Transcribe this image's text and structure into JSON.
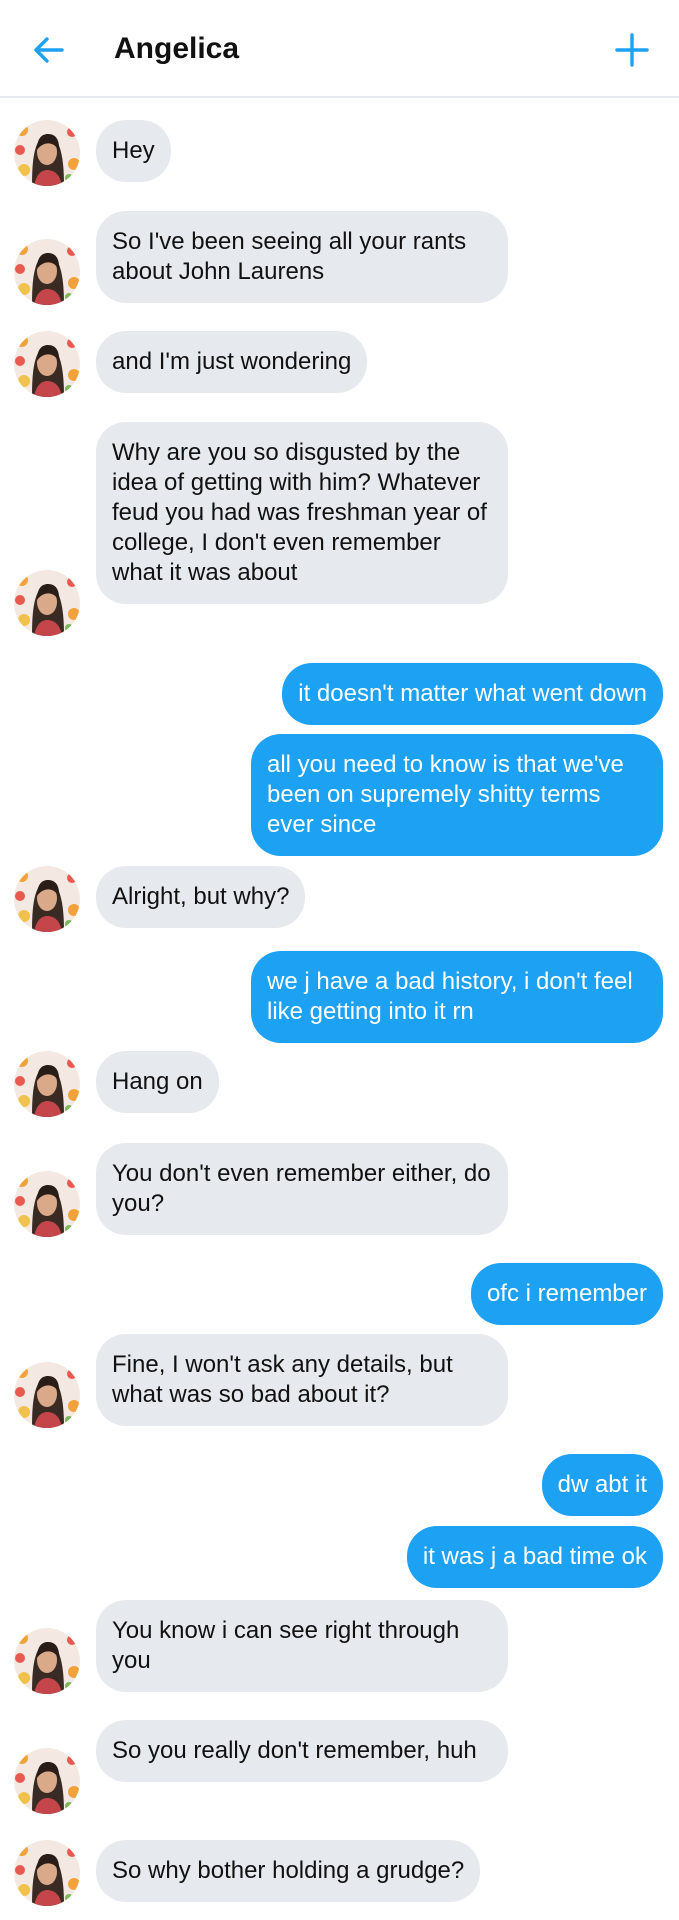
{
  "header": {
    "title": "Angelica"
  },
  "colors": {
    "accent": "#1da1f2",
    "incoming_bubble": "#e6e9ee",
    "outgoing_bubble": "#1da1f2"
  },
  "icons": {
    "back": "arrow-left-icon",
    "add": "plus-icon",
    "avatar": "avatar-photo"
  },
  "messages": [
    {
      "from": "them",
      "text": "Hey"
    },
    {
      "from": "them",
      "text": "So I've been seeing all your rants about John Laurens"
    },
    {
      "from": "them",
      "text": "and I'm just wondering"
    },
    {
      "from": "them",
      "text": "Why are you so disgusted by the idea of getting with him? Whatever feud you had was freshman year of college, I don't even remember what it was about"
    },
    {
      "from": "me",
      "text": "it doesn't matter what went down"
    },
    {
      "from": "me",
      "text": "all you need to know is that we've been on supremely shitty terms ever since"
    },
    {
      "from": "them",
      "text": "Alright, but why?"
    },
    {
      "from": "me",
      "text": "we j have a bad history, i don't feel like getting into it rn"
    },
    {
      "from": "them",
      "text": "Hang on"
    },
    {
      "from": "them",
      "text": "You don't even remember either, do you?"
    },
    {
      "from": "me",
      "text": "ofc i remember"
    },
    {
      "from": "them",
      "text": "Fine, I won't ask any details, but what was so bad about it?"
    },
    {
      "from": "me",
      "text": "dw abt it"
    },
    {
      "from": "me",
      "text": "it was j a bad time ok"
    },
    {
      "from": "them",
      "text": "You know i can see right through you"
    },
    {
      "from": "them",
      "text": "So you really don't remember, huh"
    },
    {
      "from": "them",
      "text": "So why bother holding a grudge?"
    }
  ]
}
